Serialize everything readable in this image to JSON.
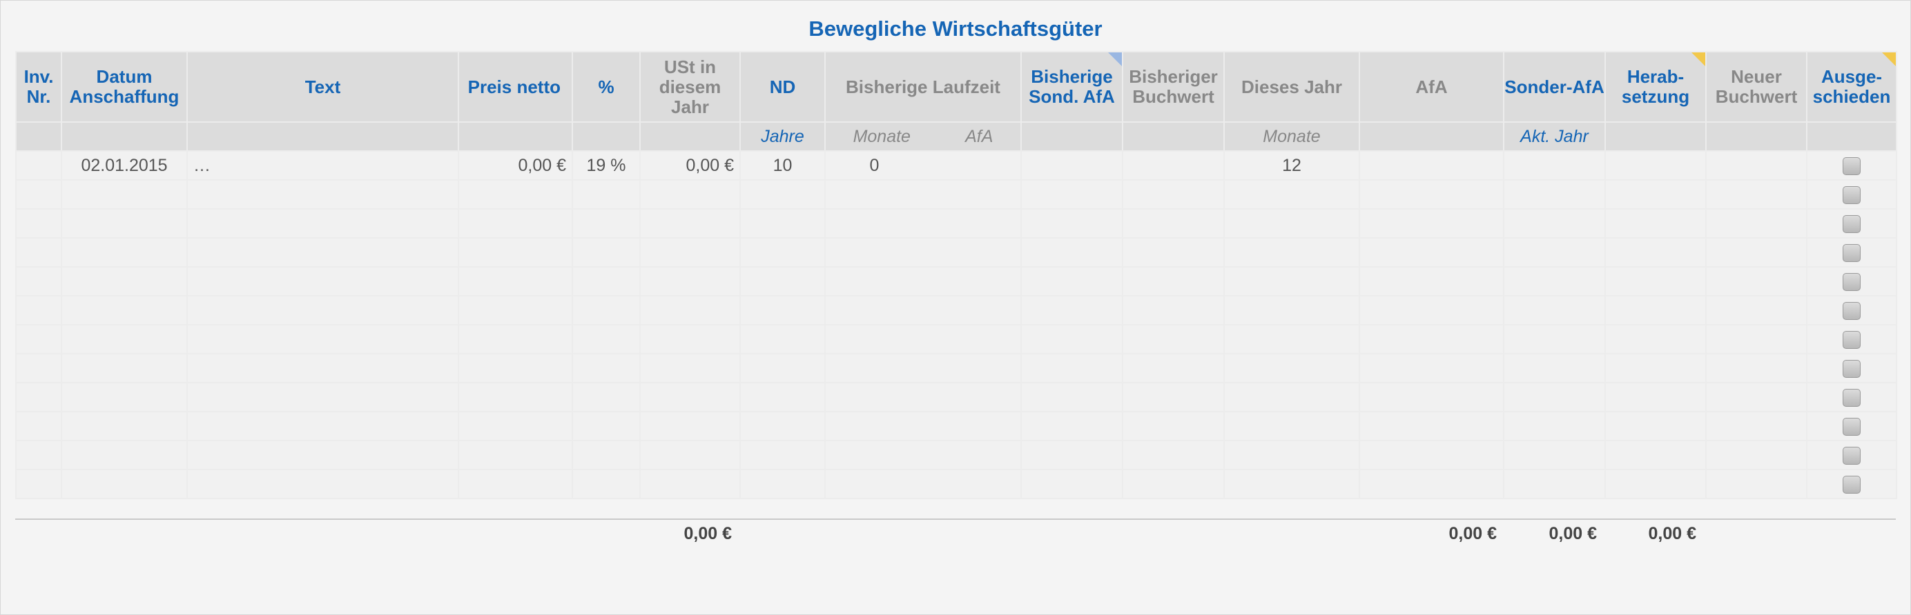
{
  "title": "Bewegliche Wirtschaftsgüter",
  "columns": {
    "inv_nr": "Inv. Nr.",
    "datum": "Datum Anschaffung",
    "text": "Text",
    "preis": "Preis netto",
    "prozent": "%",
    "ust": "USt in diesem Jahr",
    "nd": "ND",
    "bisherige_laufzeit": "Bisherige Laufzeit",
    "bisherige_sond_afa": "Bisherige Sond. AfA",
    "bisheriger_buchwert": "Bisheriger Buchwert",
    "dieses_jahr": "Dieses Jahr",
    "afa": "AfA",
    "sonder_afa": "Sonder-AfA",
    "herabsetzung": "Herab-setzung",
    "neuer_buchwert": "Neuer Buchwert",
    "ausgeschieden": "Ausge-schieden"
  },
  "subheaders": {
    "nd": "Jahre",
    "laufzeit_monate": "Monate",
    "laufzeit_afa": "AfA",
    "dieses_jahr": "Monate",
    "sonder_afa": "Akt. Jahr"
  },
  "row1": {
    "datum": "02.01.2015",
    "text": "…",
    "preis": "0,00 €",
    "prozent": "19 %",
    "ust": "0,00 €",
    "nd": "10",
    "laufzeit_monate": "0",
    "dieses_jahr": "12"
  },
  "row_count": 12,
  "totals": {
    "ust": "0,00 €",
    "afa": "0,00 €",
    "sonder_afa": "0,00 €",
    "herabsetzung": "0,00 €"
  },
  "colors": {
    "accent": "#1565b5",
    "muted": "#888888",
    "corner_blue": "#9ab7e2",
    "corner_yellow": "#f2c84b"
  }
}
